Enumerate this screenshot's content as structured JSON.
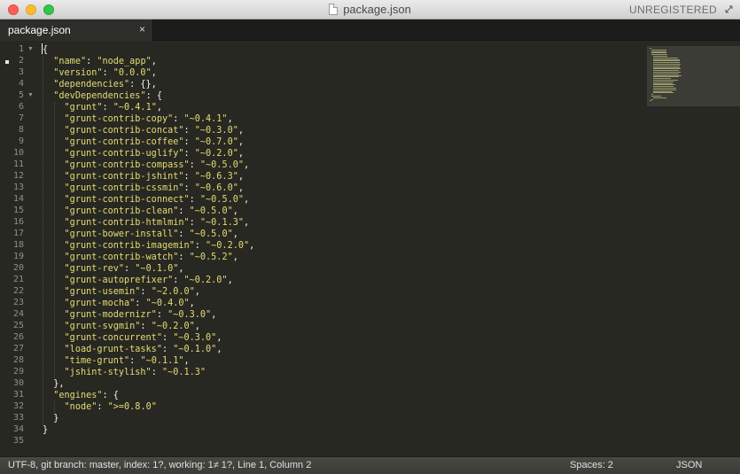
{
  "window": {
    "title": "package.json",
    "registration": "UNREGISTERED"
  },
  "tabs": [
    {
      "label": "package.json",
      "close_glyph": "×"
    }
  ],
  "editor": {
    "fold_glyph": "▼",
    "line_numbers": [
      "1",
      "2",
      "3",
      "4",
      "5",
      "6",
      "7",
      "8",
      "9",
      "10",
      "11",
      "12",
      "13",
      "14",
      "15",
      "16",
      "17",
      "18",
      "19",
      "20",
      "21",
      "22",
      "23",
      "24",
      "25",
      "26",
      "27",
      "28",
      "29",
      "30",
      "31",
      "32",
      "33",
      "34",
      "35"
    ],
    "lines": [
      "{",
      "  \"name\": \"node_app\",",
      "  \"version\": \"0.0.0\",",
      "  \"dependencies\": {},",
      "  \"devDependencies\": {",
      "    \"grunt\": \"~0.4.1\",",
      "    \"grunt-contrib-copy\": \"~0.4.1\",",
      "    \"grunt-contrib-concat\": \"~0.3.0\",",
      "    \"grunt-contrib-coffee\": \"~0.7.0\",",
      "    \"grunt-contrib-uglify\": \"~0.2.0\",",
      "    \"grunt-contrib-compass\": \"~0.5.0\",",
      "    \"grunt-contrib-jshint\": \"~0.6.3\",",
      "    \"grunt-contrib-cssmin\": \"~0.6.0\",",
      "    \"grunt-contrib-connect\": \"~0.5.0\",",
      "    \"grunt-contrib-clean\": \"~0.5.0\",",
      "    \"grunt-contrib-htmlmin\": \"~0.1.3\",",
      "    \"grunt-bower-install\": \"~0.5.0\",",
      "    \"grunt-contrib-imagemin\": \"~0.2.0\",",
      "    \"grunt-contrib-watch\": \"~0.5.2\",",
      "    \"grunt-rev\": \"~0.1.0\",",
      "    \"grunt-autoprefixer\": \"~0.2.0\",",
      "    \"grunt-usemin\": \"~2.0.0\",",
      "    \"grunt-mocha\": \"~0.4.0\",",
      "    \"grunt-modernizr\": \"~0.3.0\",",
      "    \"grunt-svgmin\": \"~0.2.0\",",
      "    \"grunt-concurrent\": \"~0.3.0\",",
      "    \"load-grunt-tasks\": \"~0.1.0\",",
      "    \"time-grunt\": \"~0.1.1\",",
      "    \"jshint-stylish\": \"~0.1.3\"",
      "  },",
      "  \"engines\": {",
      "    \"node\": \">=0.8.0\"",
      "  }",
      "}",
      ""
    ]
  },
  "status_bar": {
    "left": "UTF-8, git branch: master, index: 1?, working: 1≠ 1?, Line 1, Column 2",
    "spaces": "Spaces: 2",
    "syntax": "JSON"
  },
  "colors": {
    "background": "#272822",
    "string": "#e6db74",
    "punctuation": "#f8f8f2",
    "line_number": "#8f908a"
  }
}
